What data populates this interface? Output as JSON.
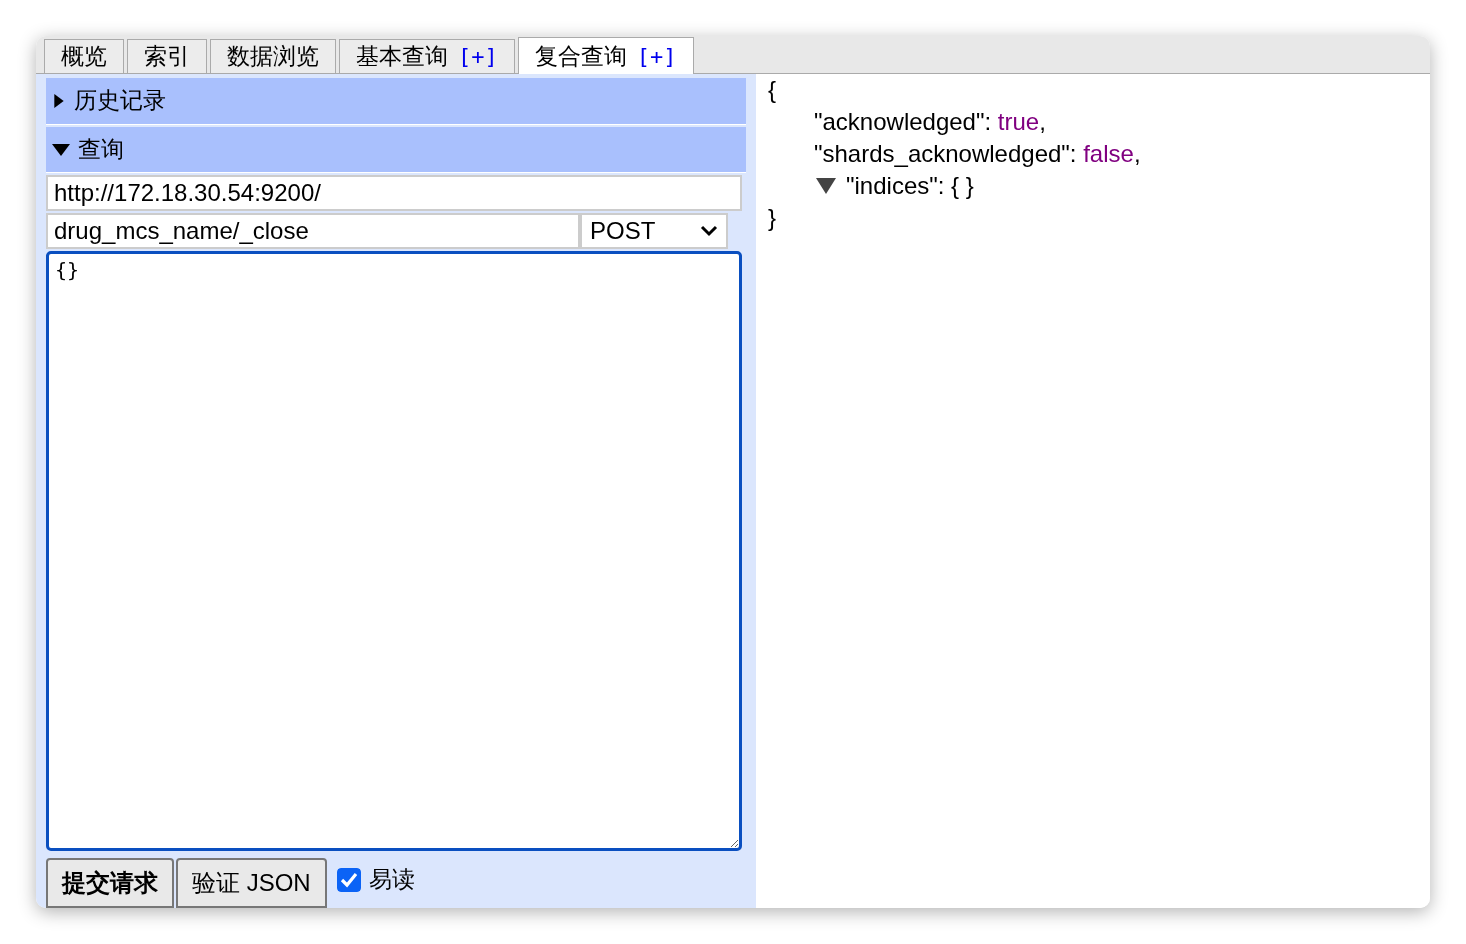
{
  "tabs": [
    {
      "label": "概览",
      "selected": false
    },
    {
      "label": "索引",
      "selected": false
    },
    {
      "label": "数据浏览",
      "selected": false
    },
    {
      "label": "基本查询",
      "plus": "[+]",
      "selected": false
    },
    {
      "label": "复合查询",
      "plus": "[+]",
      "selected": true
    }
  ],
  "sections": [
    {
      "title": "历史记录",
      "expanded": false
    },
    {
      "title": "查询",
      "expanded": true
    }
  ],
  "query": {
    "url": "http://172.18.30.54:9200/",
    "path": "drug_mcs_name/_close",
    "method": "POST",
    "body": "{}"
  },
  "buttons": [
    {
      "label": "提交请求",
      "kind": "primary"
    },
    {
      "label": "验证 JSON",
      "kind": "normal"
    }
  ],
  "readable": {
    "label": "易读",
    "checked": true
  },
  "result": {
    "open": "{",
    "close": "}",
    "entries": [
      {
        "key": "\"acknowledged\": ",
        "value": "true",
        "suffix": ",",
        "kind": "literal"
      },
      {
        "key": "\"shards_acknowledged\": ",
        "value": "false",
        "suffix": ",",
        "kind": "literal"
      },
      {
        "key": "\"indices\": ",
        "value": "{ }",
        "kind": "object",
        "expanded": true
      }
    ]
  }
}
